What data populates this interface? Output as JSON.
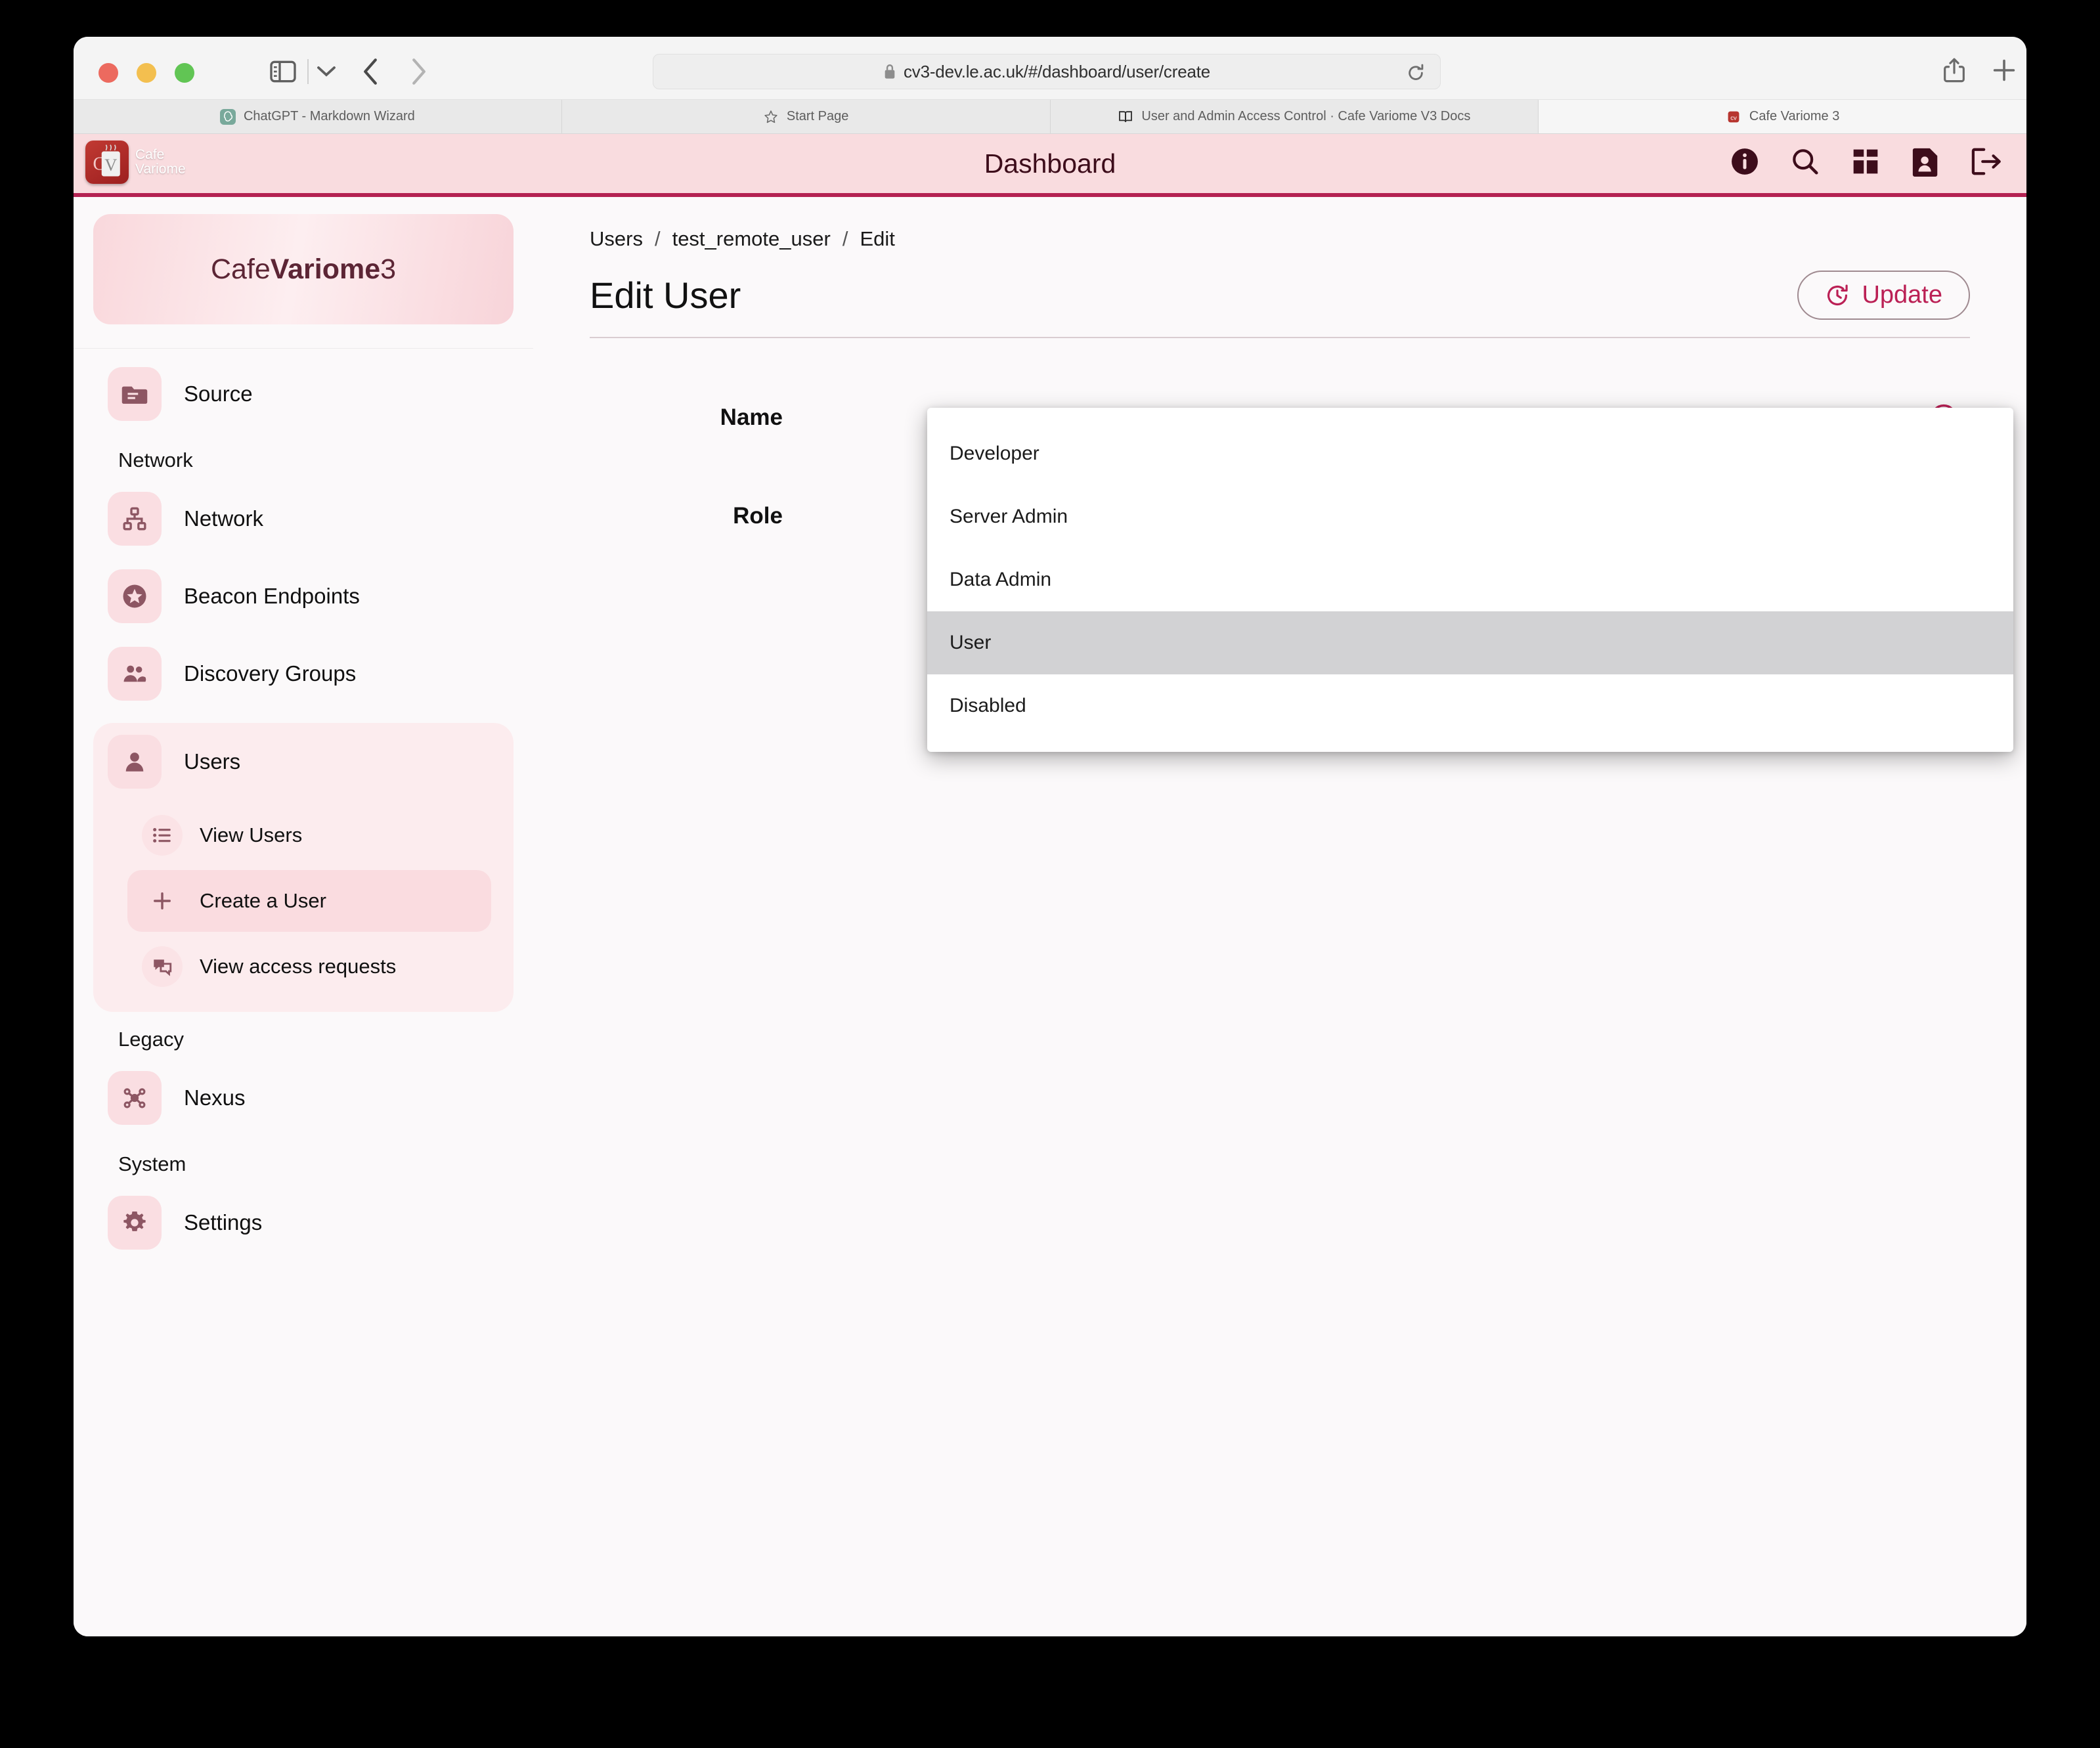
{
  "browser": {
    "url": "cv3-dev.le.ac.uk/#/dashboard/user/create",
    "lock_icon": "lock-icon",
    "reload_icon": "reload-icon",
    "back_icon": "chevron-left-icon",
    "forward_icon": "chevron-right-icon",
    "sidebar_toggle_icon": "sidebar-toggle-icon",
    "share_icon": "share-icon",
    "new_tab_icon": "plus-icon",
    "tab_overview_icon": "tab-overview-icon",
    "tabs": [
      {
        "title": "ChatGPT - Markdown Wizard",
        "favicon": "chatgpt-icon",
        "active": false
      },
      {
        "title": "Start Page",
        "favicon": "star-icon",
        "active": false
      },
      {
        "title": "User and Admin Access Control · Cafe Variome V3 Docs",
        "favicon": "book-icon",
        "active": false
      },
      {
        "title": "Cafe Variome 3",
        "favicon": "cafe-variome-icon",
        "active": true
      }
    ]
  },
  "app_header": {
    "title": "Dashboard",
    "logo_line1": "Cafe",
    "logo_line2": "Variome",
    "logo_mark": "CV",
    "icons": [
      {
        "name": "info-icon",
        "label": "Info"
      },
      {
        "name": "search-icon",
        "label": "Search"
      },
      {
        "name": "dashboard-grid-icon",
        "label": "Dashboard"
      },
      {
        "name": "user-document-icon",
        "label": "Profile"
      },
      {
        "name": "logout-icon",
        "label": "Log out"
      }
    ],
    "bar_background": "#f9dcdf",
    "bar_border": "#b42252",
    "title_color": "#3d0d1b"
  },
  "sidebar": {
    "brand_prefix": "Cafe ",
    "brand_bold": "Variome",
    "brand_suffix": " 3",
    "nodes": [
      {
        "type": "item",
        "label": "Source",
        "icon": "folder-icon"
      },
      {
        "type": "section",
        "label": "Network"
      },
      {
        "type": "item",
        "label": "Network",
        "icon": "sitemap-icon"
      },
      {
        "type": "item",
        "label": "Beacon Endpoints",
        "icon": "star-circle-icon"
      },
      {
        "type": "item",
        "label": "Discovery Groups",
        "icon": "people-icon"
      }
    ],
    "users_group": {
      "label": "Users",
      "icon": "person-icon",
      "subitems": [
        {
          "label": "View Users",
          "icon": "list-icon",
          "active": false
        },
        {
          "label": "Create a User",
          "icon": "plus-icon",
          "active": true
        },
        {
          "label": "View access requests",
          "icon": "chat-icon",
          "active": false
        }
      ]
    },
    "tail_nodes": [
      {
        "type": "section",
        "label": "Legacy"
      },
      {
        "type": "item",
        "label": "Nexus",
        "icon": "nexus-icon"
      },
      {
        "type": "section",
        "label": "System"
      },
      {
        "type": "item",
        "label": "Settings",
        "icon": "gear-icon"
      }
    ]
  },
  "main": {
    "breadcrumb": [
      "Users",
      "test_remote_user",
      "Edit"
    ],
    "breadcrumb_separator": "/",
    "page_title": "Edit User",
    "update_button": {
      "label": "Update",
      "icon": "clock-refresh-icon",
      "color": "#bb2055"
    },
    "fields": [
      {
        "label": "Name",
        "value": "",
        "help_icon": "help-circle-icon"
      },
      {
        "label": "Role",
        "value": "User",
        "help_icon": "help-circle-icon"
      }
    ]
  },
  "role_dropdown": {
    "open": true,
    "options": [
      {
        "label": "Developer",
        "selected": false
      },
      {
        "label": "Server Admin",
        "selected": false
      },
      {
        "label": "Data Admin",
        "selected": false
      },
      {
        "label": "User",
        "selected": true
      },
      {
        "label": "Disabled",
        "selected": false
      }
    ],
    "selected_background": "#d2d2d4"
  }
}
